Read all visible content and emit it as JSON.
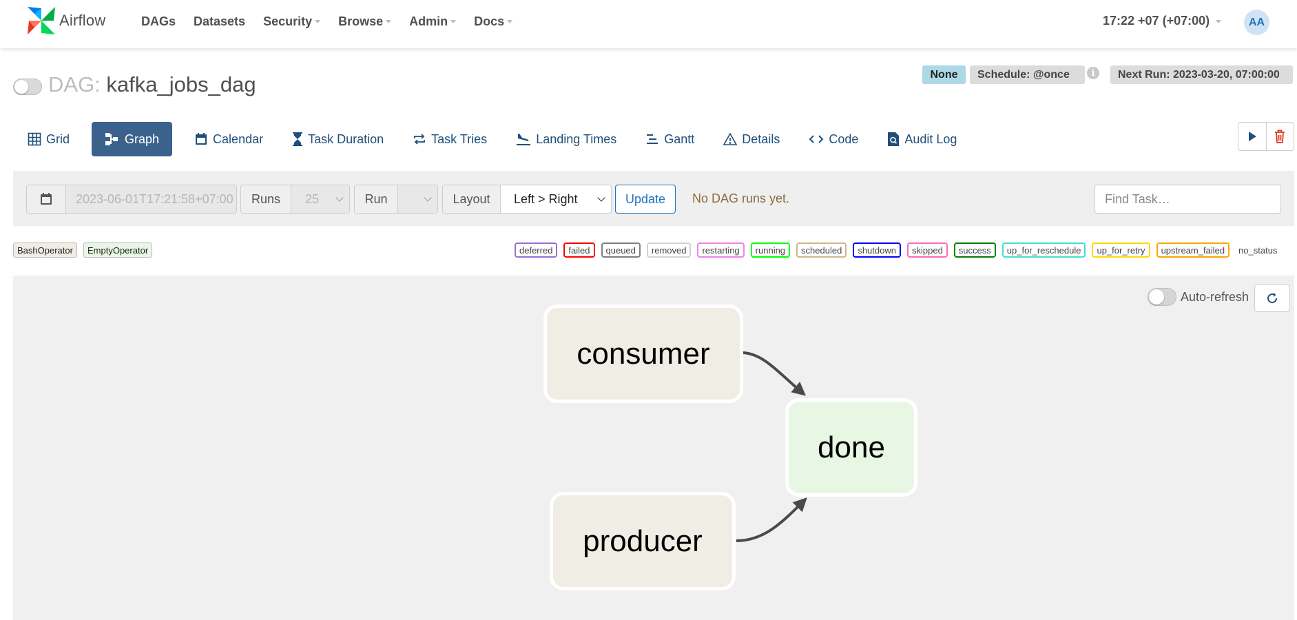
{
  "app": {
    "brand": "Airflow"
  },
  "nav": {
    "items": [
      {
        "label": "DAGs",
        "dropdown": false
      },
      {
        "label": "Datasets",
        "dropdown": false
      },
      {
        "label": "Security",
        "dropdown": true
      },
      {
        "label": "Browse",
        "dropdown": true
      },
      {
        "label": "Admin",
        "dropdown": true
      },
      {
        "label": "Docs",
        "dropdown": true
      }
    ],
    "time": "17:22 +07 (+07:00)",
    "user_initials": "AA"
  },
  "dag": {
    "prefix": "DAG:",
    "name": "kafka_jobs_dag",
    "paused": true,
    "badge_none": "None",
    "schedule": "Schedule: @once",
    "info_icon": "i",
    "next_run": "Next Run: 2023-03-20, 07:00:00"
  },
  "tabs": [
    {
      "label": "Grid",
      "icon": "grid-icon"
    },
    {
      "label": "Graph",
      "icon": "graph-icon",
      "active": true
    },
    {
      "label": "Calendar",
      "icon": "calendar-icon"
    },
    {
      "label": "Task Duration",
      "icon": "hourglass-icon"
    },
    {
      "label": "Task Tries",
      "icon": "repeat-icon"
    },
    {
      "label": "Landing Times",
      "icon": "plane-landing-icon"
    },
    {
      "label": "Gantt",
      "icon": "gantt-icon"
    },
    {
      "label": "Details",
      "icon": "warning-triangle-icon"
    },
    {
      "label": "Code",
      "icon": "code-icon"
    },
    {
      "label": "Audit Log",
      "icon": "file-search-icon"
    }
  ],
  "actions": {
    "trigger_icon": "play-icon",
    "delete_icon": "trash-icon"
  },
  "filters": {
    "date_value": "2023-06-01T17:21:58+07:00",
    "runs_label": "Runs",
    "runs_value": "25",
    "run_label": "Run",
    "run_value": "",
    "layout_label": "Layout",
    "layout_value": "Left > Right",
    "update_label": "Update",
    "status_text": "No DAG runs yet.",
    "find_placeholder": "Find Task…"
  },
  "operators": [
    {
      "label": "BashOperator",
      "color": "#f0ede4"
    },
    {
      "label": "EmptyOperator",
      "color": "#e8f7e4"
    }
  ],
  "states": [
    {
      "label": "deferred",
      "color": "#9370db"
    },
    {
      "label": "failed",
      "color": "#ff0000"
    },
    {
      "label": "queued",
      "color": "#808080"
    },
    {
      "label": "removed",
      "color": "#d3d3d3"
    },
    {
      "label": "restarting",
      "color": "#ee82ee"
    },
    {
      "label": "running",
      "color": "#00ff00"
    },
    {
      "label": "scheduled",
      "color": "#d2b48c"
    },
    {
      "label": "shutdown",
      "color": "#0000ff"
    },
    {
      "label": "skipped",
      "color": "#ff69b4"
    },
    {
      "label": "success",
      "color": "#008000"
    },
    {
      "label": "up_for_reschedule",
      "color": "#40e0d0"
    },
    {
      "label": "up_for_retry",
      "color": "#ffd700"
    },
    {
      "label": "upstream_failed",
      "color": "#ffa500"
    },
    {
      "label": "no_status",
      "color": ""
    }
  ],
  "graph": {
    "auto_refresh_label": "Auto-refresh",
    "auto_refresh_on": false,
    "nodes": [
      {
        "id": "consumer",
        "label": "consumer",
        "operator": "BashOperator",
        "color": "#f0ede4"
      },
      {
        "id": "producer",
        "label": "producer",
        "operator": "BashOperator",
        "color": "#f0ede4"
      },
      {
        "id": "done",
        "label": "done",
        "operator": "EmptyOperator",
        "color": "#e8f7e4"
      }
    ],
    "edges": [
      {
        "from": "consumer",
        "to": "done"
      },
      {
        "from": "producer",
        "to": "done"
      }
    ]
  }
}
